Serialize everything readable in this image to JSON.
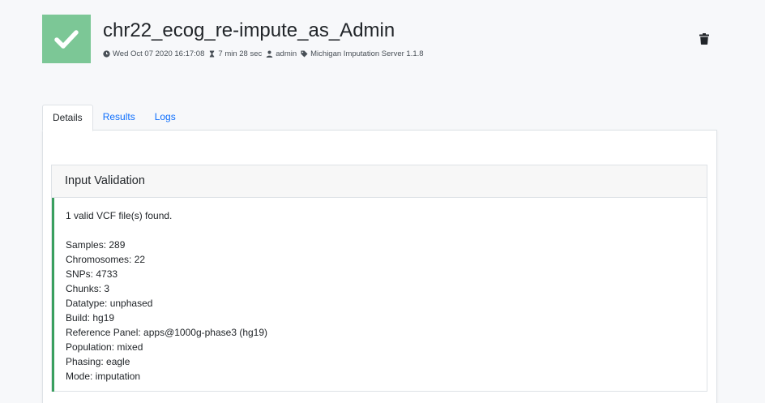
{
  "job": {
    "title": "chr22_ecog_re-impute_as_Admin",
    "status_icon": "check-icon",
    "status_color": "#7cc796"
  },
  "meta": {
    "date": "Wed Oct 07 2020 16:17:08",
    "duration": "7 min 28 sec",
    "user": "admin",
    "server": "Michigan Imputation Server 1.1.8"
  },
  "tabs": [
    {
      "label": "Details",
      "active": true
    },
    {
      "label": "Results",
      "active": false
    },
    {
      "label": "Logs",
      "active": false
    }
  ],
  "validation": {
    "header": "Input Validation",
    "summary": "1 valid VCF file(s) found.",
    "lines": [
      "Samples: 289",
      "Chromosomes: 22",
      "SNPs: 4733",
      "Chunks: 3",
      "Datatype: unphased",
      "Build: hg19",
      "Reference Panel: apps@1000g-phase3 (hg19)",
      "Population: mixed",
      "Phasing: eagle",
      "Mode: imputation"
    ],
    "accent_color": "#3a9f5f"
  },
  "colors": {
    "link": "#0d6efd",
    "background": "#f7f8fa"
  }
}
